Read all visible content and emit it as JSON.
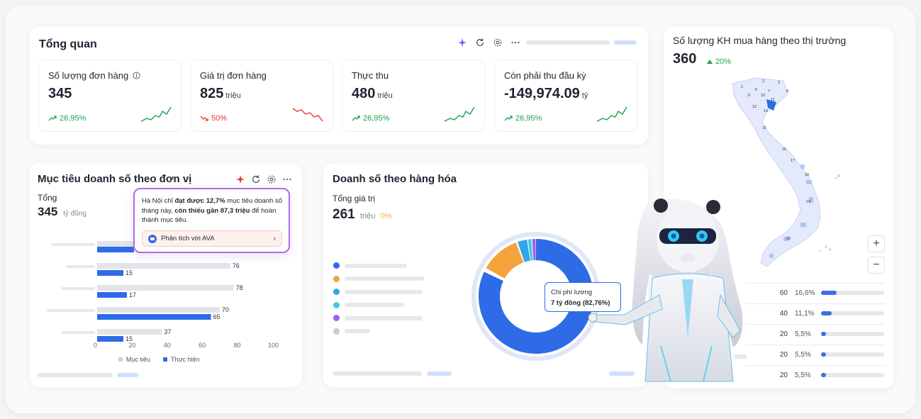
{
  "overview": {
    "title": "Tổng quan",
    "kpis": [
      {
        "label": "Số lượng đơn hàng",
        "value": "345",
        "unit": "",
        "trend": "26,95%",
        "direction": "up",
        "has_info": true
      },
      {
        "label": "Giá trị đơn hàng",
        "value": "825",
        "unit": "triệu",
        "trend": "50%",
        "direction": "down",
        "has_info": false
      },
      {
        "label": "Thực thu",
        "value": "480",
        "unit": "triệu",
        "trend": "26,95%",
        "direction": "up",
        "has_info": false
      },
      {
        "label": "Còn phải thu đầu kỳ",
        "value": "-149,974.09",
        "unit": "tỷ",
        "trend": "26,95%",
        "direction": "up",
        "has_info": false
      }
    ]
  },
  "target": {
    "title": "Mục tiêu doanh số theo đơn vị",
    "total_label": "Tổng",
    "total_value": "345",
    "total_unit": "tỷ đồng",
    "tooltip": {
      "prefix": "Hà Nội chỉ",
      "achieved": "đạt được 12,7%",
      "middle": "mục tiêu doanh số tháng này,",
      "missing": "còn thiếu gần 87,3 triệu",
      "suffix": "để hoàn thành mục tiêu.",
      "button_label": "Phân tích với AVA"
    },
    "legend_target": "Mục tiêu",
    "legend_actual": "Thực hiện"
  },
  "chart_data": {
    "type": "bar",
    "orientation": "horizontal",
    "categories": [
      "",
      "",
      "",
      "",
      ""
    ],
    "series": [
      {
        "name": "Mục tiêu",
        "values": [
          null,
          76,
          78,
          70,
          37
        ]
      },
      {
        "name": "Thực hiện",
        "values": [
          null,
          15,
          17,
          65,
          15
        ]
      }
    ],
    "x_ticks": [
      "0",
      "20",
      "40",
      "60",
      "80",
      "100"
    ],
    "xlim": [
      0,
      100
    ],
    "legend": "bottom"
  },
  "goods": {
    "title": "Doanh số theo hàng hóa",
    "total_label": "Tổng giá trị",
    "total_value": "261",
    "total_unit": "triệu",
    "total_change": "0%",
    "tooltip_title": "Chi phí lương",
    "tooltip_value": "7 tỷ đồng (82,76%)"
  },
  "market": {
    "title": "Số lượng KH mua hàng theo thị trường",
    "value": "360",
    "change": "20%",
    "zoom_in": "+",
    "zoom_out": "−",
    "rows": [
      {
        "count": "60",
        "pct": "16,6%",
        "fill": 0.25
      },
      {
        "count": "40",
        "pct": "11,1%",
        "fill": 0.17
      },
      {
        "count": "20",
        "pct": "5,5%",
        "fill": 0.08
      },
      {
        "count": "20",
        "pct": "5,5%",
        "fill": 0.08
      },
      {
        "count": "20",
        "pct": "5,5%",
        "fill": 0.08
      }
    ],
    "map_labels": [
      "1",
      "2",
      "3",
      "5",
      "7",
      "8",
      "9",
      "10",
      "11",
      "12",
      "13",
      "15",
      "16",
      "17",
      "18",
      "19",
      "20"
    ]
  },
  "colors": {
    "primary": "#2e6be6",
    "up": "#1aa34a",
    "down": "#e5372f",
    "orange": "#f5a23c",
    "purple": "#a25ee8"
  }
}
